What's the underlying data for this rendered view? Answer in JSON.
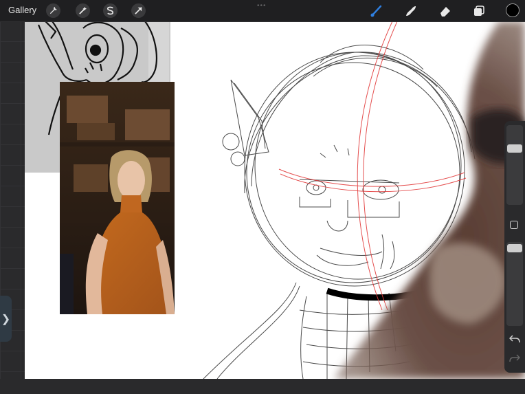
{
  "toolbar": {
    "gallery_label": "Gallery",
    "actions_icon": "wrench-icon",
    "adjustments_icon": "magic-wand-icon",
    "selection_icon": "selection-s-icon",
    "transform_icon": "arrow-cursor-icon",
    "brush_icon": "brush-icon",
    "smudge_icon": "smudge-icon",
    "eraser_icon": "eraser-icon",
    "layers_icon": "layers-icon",
    "active_color": "#000000",
    "active_tool_color": "#2f7fe0"
  },
  "sidebar": {
    "brush_size_level": 0.27,
    "opacity_level": 0.03,
    "modify_icon": "square-modify-icon",
    "undo_icon": "undo-icon",
    "redo_icon": "redo-icon"
  },
  "side_tab_glyph": "❯"
}
